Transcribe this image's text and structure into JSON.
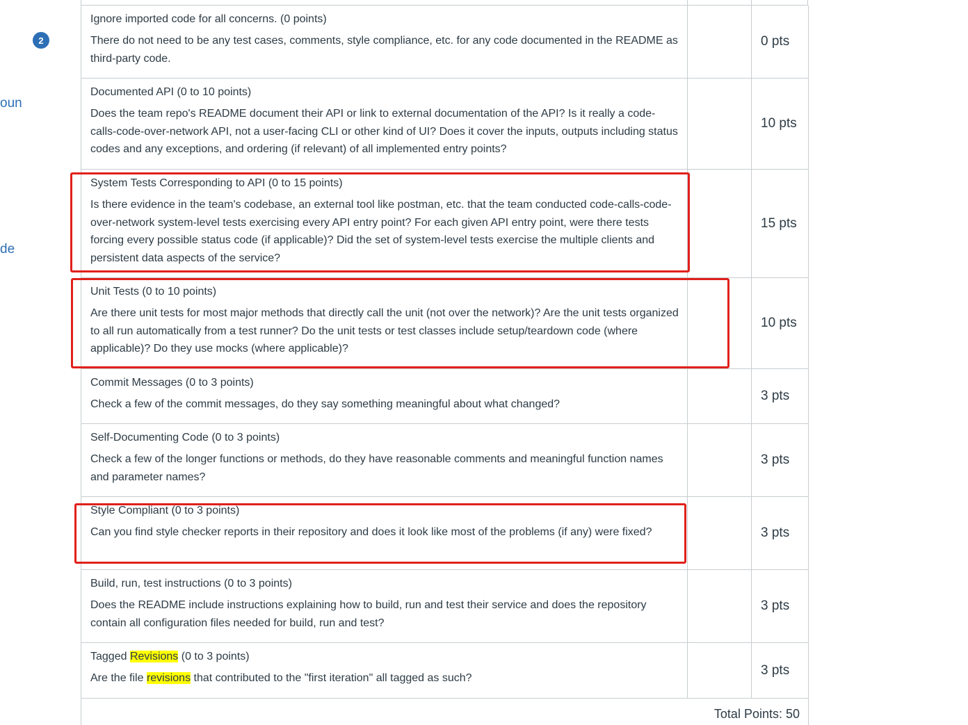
{
  "sidebar": {
    "badge_count": "2",
    "fragments": [
      "oun",
      "de"
    ]
  },
  "rubric": {
    "rows": [
      {
        "title": "Ignore imported code for all concerns. (0 points)",
        "description": "There do not need to be any test cases, comments, style compliance, etc. for any code documented in the README as third-party code.",
        "points": "0 pts"
      },
      {
        "title": "Documented API (0 to 10 points)",
        "description": "Does the team repo's README document their API or link to external documentation of the API? Is it really a code-calls-code-over-network API, not a user-facing CLI or other kind of UI? Does it cover the inputs, outputs including status codes and any exceptions, and ordering (if relevant) of all implemented entry points?",
        "points": "10 pts"
      },
      {
        "title": "System Tests Corresponding to API (0 to 15 points)",
        "description": "Is there evidence in the team's codebase, an external tool like postman, etc. that the team conducted code-calls-code-over-network system-level tests exercising every API entry point? For each given API entry point, were there tests forcing every possible status code (if applicable)? Did the set of system-level tests exercise the multiple clients and persistent data aspects of the service?",
        "points": "15 pts"
      },
      {
        "title": "Unit Tests (0 to 10 points)",
        "description": "Are there unit tests for most major methods that directly call the unit (not over the network)? Are the unit tests organized to all run automatically from a test runner? Do the unit tests or test classes include setup/teardown code (where applicable)? Do they use mocks (where applicable)?",
        "points": "10 pts"
      },
      {
        "title": "Commit Messages (0 to 3 points)",
        "description": "Check a few of the commit messages, do they say something meaningful about what changed?",
        "points": "3 pts"
      },
      {
        "title": "Self-Documenting Code (0 to 3 points)",
        "description": "Check a few of the longer functions or methods, do they have reasonable comments and meaningful function names and parameter names?",
        "points": "3 pts"
      },
      {
        "title": "Style Compliant (0 to 3 points)",
        "description": "Can you find style checker reports in their repository and does it look like most of the problems (if any) were fixed?",
        "points": "3 pts"
      },
      {
        "title": "Build, run, test instructions (0 to 3 points)",
        "description": "Does the README include instructions explaining how to build, run and test their service and does the repository contain all configuration files needed for build, run and test?",
        "points": "3 pts"
      },
      {
        "title_parts": [
          "Tagged ",
          "Revisions",
          " (0 to 3 points)"
        ],
        "description_parts": [
          "Are the file ",
          "revisions",
          " that contributed to the \"first iteration\" all tagged as such?"
        ],
        "points": "3 pts"
      }
    ],
    "total": "Total Points: 50"
  },
  "colors": {
    "highlight": "#ffff00",
    "annotation_box": "#e0201b",
    "link_blue": "#2d6fb5",
    "border": "#c7cdd1"
  }
}
